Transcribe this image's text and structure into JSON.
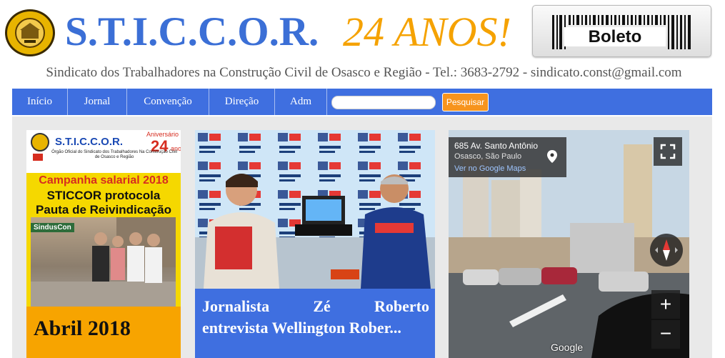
{
  "header": {
    "brand": "S.T.I.C.C.O.R.",
    "anniversary": "24 ANOS!",
    "boleto_label": "Boleto",
    "subline": "Sindicato dos Trabalhadores na Construção Civil de Osasco e Região - Tel.: 3683-2792 - sindicato.const@gmail.com"
  },
  "nav": {
    "items": [
      "Início",
      "Jornal",
      "Convenção",
      "Direção",
      "Adm"
    ],
    "search_placeholder": "",
    "search_button": "Pesquisar"
  },
  "cards": {
    "newspaper": {
      "brand": "S.T.I.C.C.O.R.",
      "anniv_label": "Aniversário",
      "anniv_num": "24",
      "anniv_unit": "anos",
      "subtitle": "Órgão Oficial do Sindicato dos Trabalhadores Na Construção Civil de Osasco e Região",
      "headline1": "Campanha salarial 2018",
      "headline2": "STICCOR protocola",
      "headline3": "Pauta de Reivindicação",
      "stamp": "SindusCon",
      "caption": "Abril 2018"
    },
    "video": {
      "title_line1": [
        "Jornalista",
        "Zé",
        "Roberto"
      ],
      "title_line2": "entrevista Wellington Rober..."
    },
    "streetview": {
      "address": "685 Av. Santo Antônio",
      "city": "Osasco, São Paulo",
      "maps_link": "Ver no Google Maps",
      "zoom_in": "+",
      "zoom_out": "−",
      "provider": "Google"
    }
  },
  "colors": {
    "brand_blue": "#3b6fd6",
    "nav_blue": "#3f6fe0",
    "anniversary_orange": "#f5a200",
    "search_button": "#f7941d"
  }
}
